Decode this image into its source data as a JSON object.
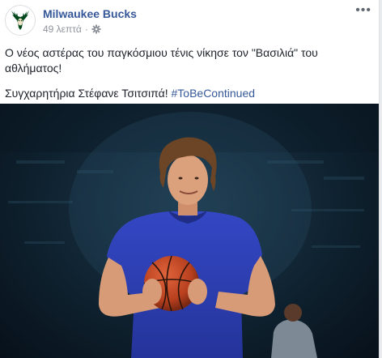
{
  "post": {
    "page_name": "Milwaukee Bucks",
    "time": "49 λεπτά",
    "more_label": "•••",
    "text_line1": "Ο νέος αστέρας του παγκόσμιου τένις νίκησε τον \"Βασιλιά\" του αθλήματος!",
    "text_line2_prefix": "Συγχαρητήρια Στέφανε Τσιτσιπά! ",
    "hashtag": "#ToBeContinued"
  },
  "icons": {
    "avatar": "bucks-logo-icon",
    "privacy": "globe-gear-icon",
    "more": "more-options-icon"
  },
  "colors": {
    "link": "#365899",
    "text": "#1d2129",
    "meta": "#90949c",
    "bucks_green": "#00471b",
    "jersey_blue": "#2d3fb5"
  }
}
